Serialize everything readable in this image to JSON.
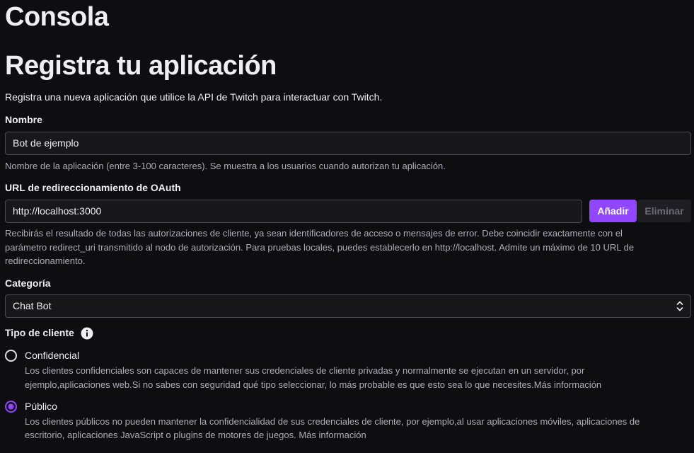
{
  "app": {
    "title": "Consola"
  },
  "page": {
    "title": "Registra tu aplicación",
    "subtitle": "Registra una nueva aplicación que utilice la API de Twitch para interactuar con Twitch."
  },
  "form": {
    "name": {
      "label": "Nombre",
      "value": "Bot de ejemplo",
      "hint": "Nombre de la aplicación (entre 3-100 caracteres). Se muestra a los usuarios cuando autorizan tu aplicación."
    },
    "redirect": {
      "label": "URL de redireccionamiento de OAuth",
      "value": "http://localhost:3000",
      "add_label": "Añadir",
      "remove_label": "Eliminar",
      "hint_line1": "Recibirás el resultado de todas las autorizaciones de cliente, ya sean identificadores de acceso o mensajes de error. Debe coincidir exactamente con el",
      "hint_line2": "parámetro redirect_uri transmitido al nodo de autorización. Para pruebas locales, puedes establecerlo en http://localhost. Admite un máximo de 10 URL de",
      "hint_line3": "redireccionamiento."
    },
    "category": {
      "label": "Categoría",
      "value": "Chat Bot"
    },
    "client_type": {
      "label": "Tipo de cliente",
      "options": [
        {
          "label": "Confidencial",
          "selected": false,
          "desc_line1": "Los clientes confidenciales son capaces de mantener sus credenciales de cliente privadas y normalmente se ejecutan en un servidor, por",
          "desc_line2": "ejemplo,aplicaciones web.Si no sabes con seguridad qué tipo seleccionar, lo más probable es que esto sea lo que necesites.Más información"
        },
        {
          "label": "Público",
          "selected": true,
          "desc_line1": "Los clientes públicos no pueden mantener la confidencialidad de sus credenciales de cliente, por ejemplo,al usar aplicaciones móviles, aplicaciones de",
          "desc_line2": "escritorio, aplicaciones JavaScript o plugins de motores de juegos. Más información"
        }
      ]
    }
  },
  "colors": {
    "background": "#0e0e10",
    "accent": "#9147ff",
    "input_bg": "#18181b",
    "muted_text": "#adadb8"
  }
}
